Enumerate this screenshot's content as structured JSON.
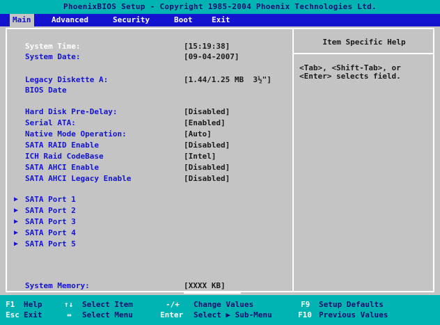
{
  "title": "PhoenixBIOS Setup - Copyright 1985-2004 Phoenix Technologies Ltd.",
  "menu": [
    {
      "label": "Main",
      "active": true
    },
    {
      "label": "Advanced",
      "active": false
    },
    {
      "label": "Security",
      "active": false
    },
    {
      "label": "Boot",
      "active": false
    },
    {
      "label": "Exit",
      "active": false
    }
  ],
  "settings": {
    "system_time": {
      "label": "System Time:",
      "value": "[15:19:38]"
    },
    "system_date": {
      "label": "System Date:",
      "value": "[09-04-2007]"
    },
    "legacy_diskette": {
      "label": "Legacy Diskette A:",
      "value": "[1.44/1.25 MB  3½\"]"
    },
    "bios_date": {
      "label": "BIOS Date"
    },
    "hdd_predelay": {
      "label": "Hard Disk Pre-Delay:",
      "value": "[Disabled]"
    },
    "serial_ata": {
      "label": "Serial ATA:",
      "value": "[Enabled]"
    },
    "native_mode": {
      "label": "Native Mode Operation:",
      "value": "[Auto]"
    },
    "sata_raid": {
      "label": "SATA RAID Enable",
      "value": "[Disabled]"
    },
    "ich_raid": {
      "label": "ICH Raid CodeBase",
      "value": "[Intel]"
    },
    "sata_ahci": {
      "label": "SATA AHCI Enable",
      "value": "[Disabled]"
    },
    "sata_ahci_legacy": {
      "label": "SATA AHCI Legacy Enable",
      "value": "[Disabled]"
    },
    "system_memory": {
      "label": "System Memory:",
      "value": "[XXXX KB]"
    }
  },
  "submenus": [
    "SATA Port 1",
    "SATA Port 2",
    "SATA Port 3",
    "SATA Port 4",
    "SATA Port 5"
  ],
  "help": {
    "title": "Item Specific Help",
    "text": "<Tab>, <Shift-Tab>, or\n<Enter> selects field."
  },
  "keys": {
    "f1": {
      "key": "F1",
      "desc": "Help"
    },
    "arrows_v": {
      "key": "↑↓",
      "desc": "Select Item"
    },
    "plusminus": {
      "key": "-/+",
      "desc": "Change Values"
    },
    "f9": {
      "key": "F9",
      "desc": "Setup Defaults"
    },
    "esc": {
      "key": "Esc",
      "desc": "Exit"
    },
    "arrows_h": {
      "key": "↔",
      "desc": "Select Menu"
    },
    "enter": {
      "key": "Enter",
      "desc": "Select ▶ Sub-Menu"
    },
    "f10": {
      "key": "F10",
      "desc": "Previous Values"
    }
  },
  "colors": {
    "background": "#c4c4c4",
    "title_bar": "#00b3b3",
    "menu_bar": "#1414d0",
    "label_blue": "#1414d0"
  }
}
